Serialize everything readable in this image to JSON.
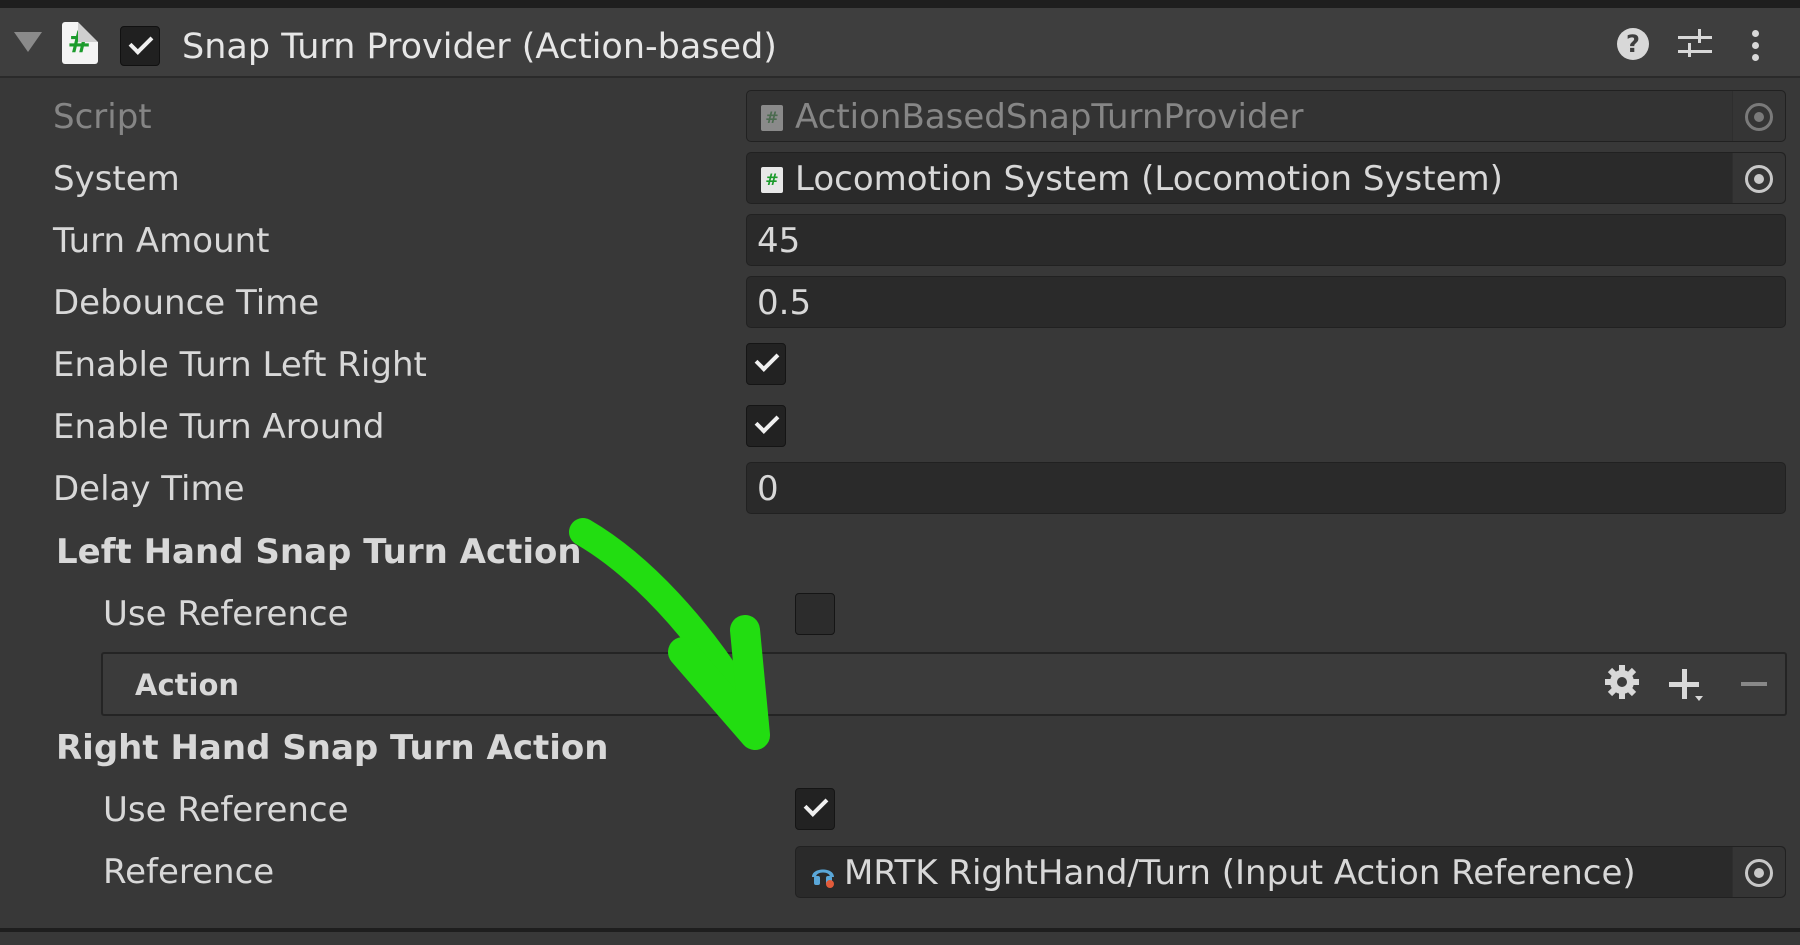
{
  "header": {
    "title": "Snap Turn Provider (Action-based)",
    "script_icon_glyph": "#",
    "enabled": true
  },
  "properties": {
    "script": {
      "label": "Script",
      "value": "ActionBasedSnapTurnProvider"
    },
    "system": {
      "label": "System",
      "value": "Locomotion System (Locomotion System)"
    },
    "turn_amount": {
      "label": "Turn Amount",
      "value": "45"
    },
    "debounce_time": {
      "label": "Debounce Time",
      "value": "0.5"
    },
    "enable_turn_left_right": {
      "label": "Enable Turn Left Right",
      "checked": true
    },
    "enable_turn_around": {
      "label": "Enable Turn Around",
      "checked": true
    },
    "delay_time": {
      "label": "Delay Time",
      "value": "0"
    }
  },
  "left_hand": {
    "heading": "Left Hand Snap Turn Action",
    "use_reference_label": "Use Reference",
    "use_reference": false,
    "action_label": "Action"
  },
  "right_hand": {
    "heading": "Right Hand Snap Turn Action",
    "use_reference_label": "Use Reference",
    "use_reference": true,
    "reference_label": "Reference",
    "reference_value": "MRTK RightHand/Turn (Input Action Reference)"
  },
  "icons": {
    "help": "?",
    "colors": {
      "background": "#383838",
      "field": "#2a2a2a",
      "annotation_arrow": "#22dd11",
      "script_hash": "#1c9b2c"
    }
  }
}
